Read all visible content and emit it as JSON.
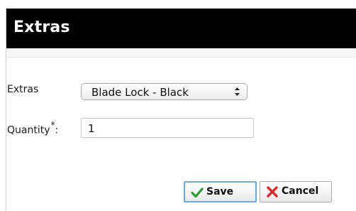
{
  "dialog": {
    "title": "Extras",
    "fields": {
      "extras_label": "Extras",
      "extras_selected": "Blade Lock - Black",
      "quantity_label": "Quantity",
      "required_marker": "*",
      "quantity_suffix": ":",
      "quantity_value": "1"
    },
    "buttons": {
      "save": "Save",
      "cancel": "Cancel"
    }
  },
  "icons": {
    "select": "updown-arrow-icon",
    "save": "checkmark-icon",
    "cancel": "close-x-icon"
  },
  "colors": {
    "titlebar": "#000000",
    "save_border": "#6fa6d8",
    "check": "#2e9b2e",
    "cancel_x": "#d42a2a"
  }
}
